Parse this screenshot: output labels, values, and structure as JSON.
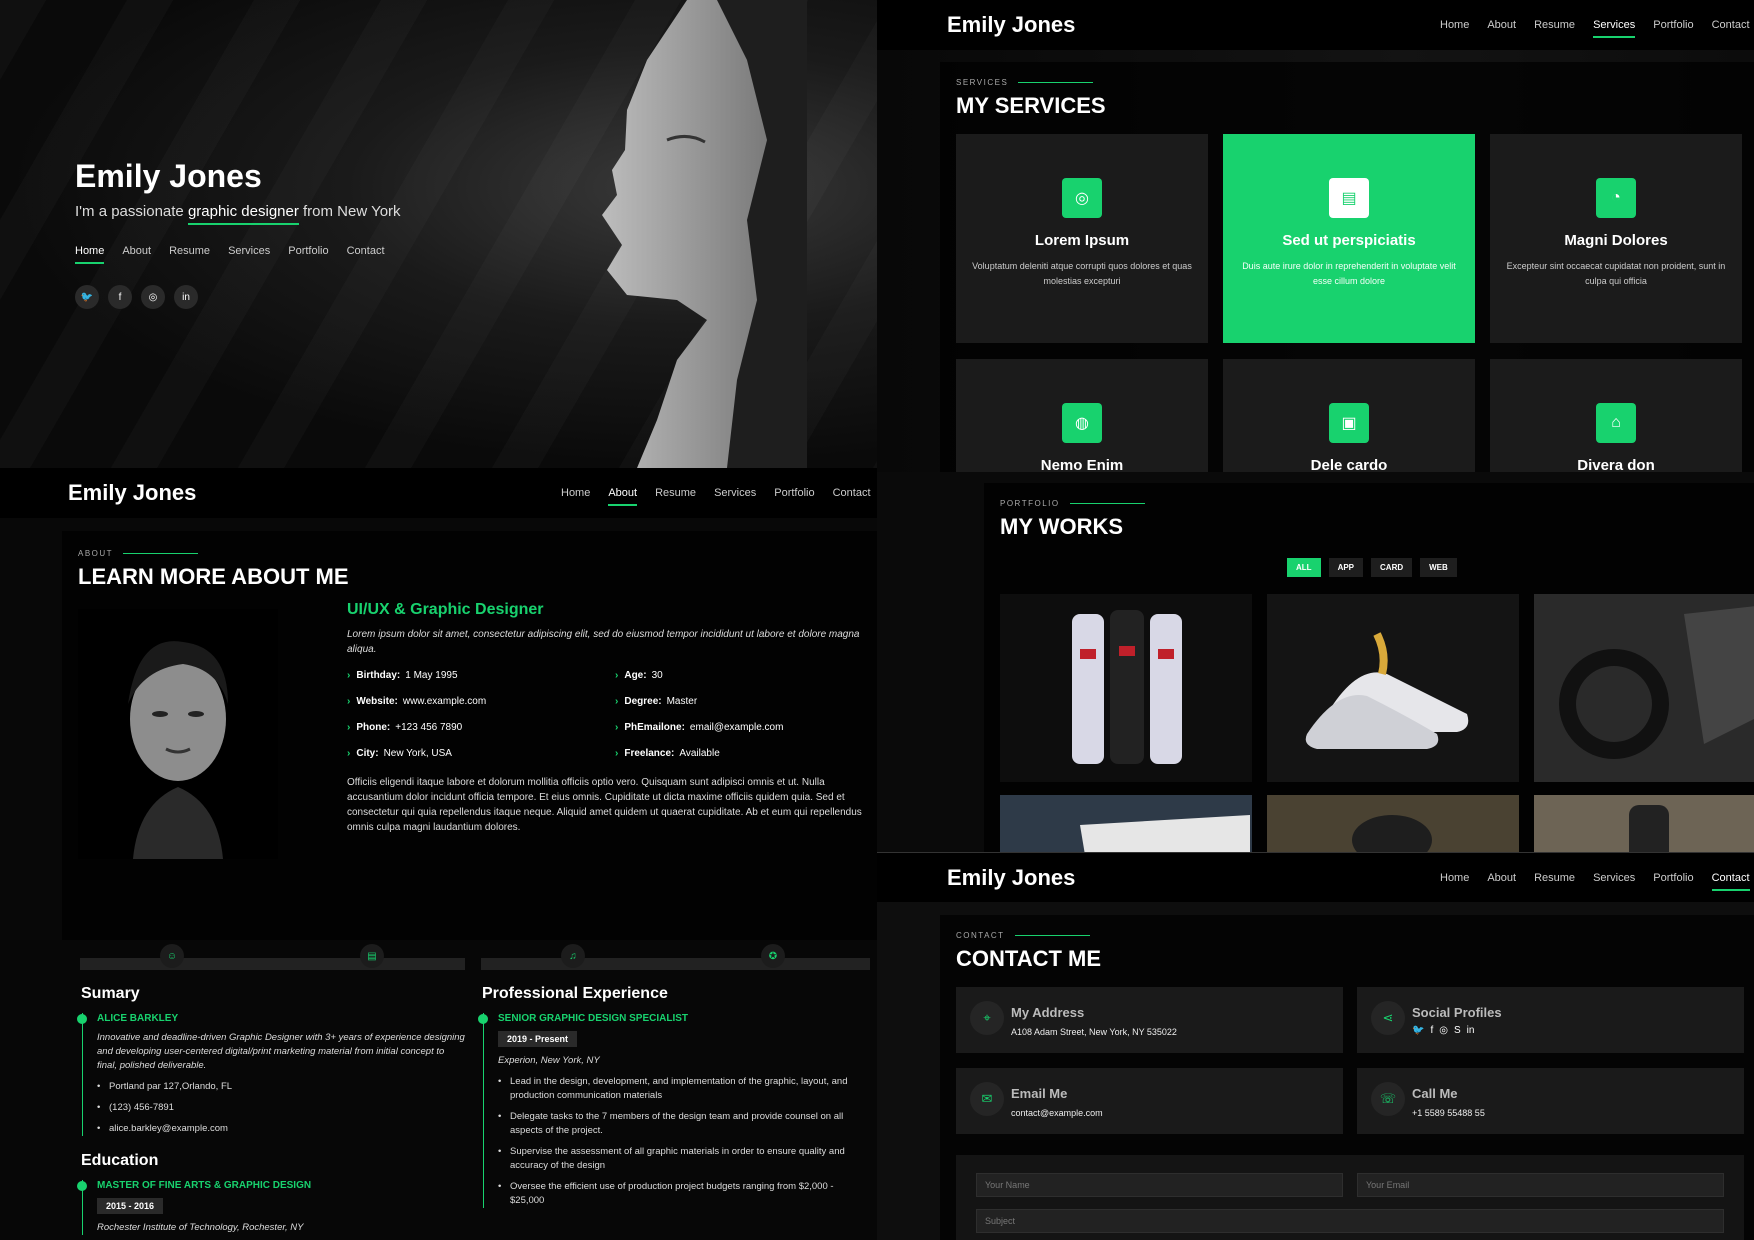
{
  "hero": {
    "name": "Emily Jones",
    "tagline_prefix": "I'm a passionate",
    "tagline_role": "graphic designer",
    "tagline_suffix": "from New York",
    "nav": [
      "Home",
      "About",
      "Resume",
      "Services",
      "Portfolio",
      "Contact"
    ],
    "active_nav": "Home",
    "social_icons": [
      "twitter-icon",
      "facebook-icon",
      "instagram-icon",
      "linkedin-icon"
    ]
  },
  "header": {
    "logo": "Emily Jones",
    "nav": [
      "Home",
      "About",
      "Resume",
      "Services",
      "Portfolio",
      "Contact"
    ]
  },
  "services": {
    "label": "SERVICES",
    "title": "MY SERVICES",
    "cards": [
      {
        "name": "Lorem Ipsum",
        "desc": "Voluptatum deleniti atque corrupti quos dolores et quas molestias excepturi",
        "icon": "dribbble-icon",
        "highlighted": false
      },
      {
        "name": "Sed ut perspiciatis",
        "desc": "Duis aute irure dolor in reprehenderit in voluptate velit esse cillum dolore",
        "icon": "file-icon",
        "highlighted": true
      },
      {
        "name": "Magni Dolores",
        "desc": "Excepteur sint occaecat cupidatat non proident, sunt in culpa qui officia",
        "icon": "speedometer-icon",
        "highlighted": false
      },
      {
        "name": "Nemo Enim",
        "desc": "",
        "icon": "globe-icon",
        "highlighted": false
      },
      {
        "name": "Dele cardo",
        "desc": "",
        "icon": "presentation-icon",
        "highlighted": false
      },
      {
        "name": "Divera don",
        "desc": "",
        "icon": "building-icon",
        "highlighted": false
      }
    ]
  },
  "about": {
    "label": "ABOUT",
    "title": "LEARN MORE ABOUT ME",
    "role": "UI/UX & Graphic Designer",
    "intro": "Lorem ipsum dolor sit amet, consectetur adipiscing elit, sed do eiusmod tempor incididunt ut labore et dolore magna aliqua.",
    "facts": [
      {
        "k": "Birthday:",
        "v": "1 May 1995"
      },
      {
        "k": "Age:",
        "v": "30"
      },
      {
        "k": "Website:",
        "v": "www.example.com"
      },
      {
        "k": "Degree:",
        "v": "Master"
      },
      {
        "k": "Phone:",
        "v": "+123 456 7890"
      },
      {
        "k": "PhEmailone:",
        "v": "email@example.com"
      },
      {
        "k": "City:",
        "v": "New York, USA"
      },
      {
        "k": "Freelance:",
        "v": "Available"
      }
    ],
    "body": "Officiis eligendi itaque labore et dolorum mollitia officiis optio vero. Quisquam sunt adipisci omnis et ut. Nulla accusantium dolor incidunt officia tempore. Et eius omnis. Cupiditate ut dicta maxime officiis quidem quia. Sed et consectetur qui quia repellendus itaque neque. Aliquid amet quidem ut quaerat cupiditate. Ab et eum qui repellendus omnis culpa magni laudantium dolores."
  },
  "works": {
    "label": "PORTFOLIO",
    "title": "MY WORKS",
    "filters": [
      "ALL",
      "APP",
      "CARD",
      "WEB"
    ],
    "active_filter": "ALL",
    "items": [
      "bottles",
      "sneakers",
      "car-interior",
      "paper",
      "helmet",
      "flask"
    ]
  },
  "resume": {
    "stat_icons": [
      "smiley-icon",
      "document-icon",
      "headset-icon",
      "award-icon"
    ],
    "summary": {
      "heading": "Sumary",
      "name": "ALICE BARKLEY",
      "desc": "Innovative and deadline-driven Graphic Designer with 3+ years of experience designing and developing user-centered digital/print marketing material from initial concept to final, polished deliverable.",
      "bullets": [
        "Portland par 127,Orlando, FL",
        "(123) 456-7891",
        "alice.barkley@example.com"
      ]
    },
    "education": {
      "heading": "Education",
      "title": "MASTER OF FINE ARTS & GRAPHIC DESIGN",
      "date": "2015 - 2016",
      "place": "Rochester Institute of Technology, Rochester, NY"
    },
    "experience": {
      "heading": "Professional Experience",
      "title": "SENIOR GRAPHIC DESIGN SPECIALIST",
      "date": "2019 - Present",
      "place": "Experion, New York, NY",
      "bullets": [
        "Lead in the design, development, and implementation of the graphic, layout, and production communication materials",
        "Delegate tasks to the 7 members of the design team and provide counsel on all aspects of the project.",
        "Supervise the assessment of all graphic materials in order to ensure quality and accuracy of the design",
        "Oversee the efficient use of production project budgets ranging from $2,000 - $25,000"
      ]
    }
  },
  "contact": {
    "label": "CONTACT",
    "title": "CONTACT ME",
    "address_title": "My Address",
    "address": "A108 Adam Street, New York, NY 535022",
    "social_title": "Social Profiles",
    "email_title": "Email Me",
    "email": "contact@example.com",
    "call_title": "Call Me",
    "phone": "+1 5589 55488 55",
    "form": {
      "name_ph": "Your Name",
      "email_ph": "Your Email",
      "subject_ph": "Subject"
    }
  },
  "colors": {
    "accent": "#18d26e",
    "background": "#000000"
  }
}
